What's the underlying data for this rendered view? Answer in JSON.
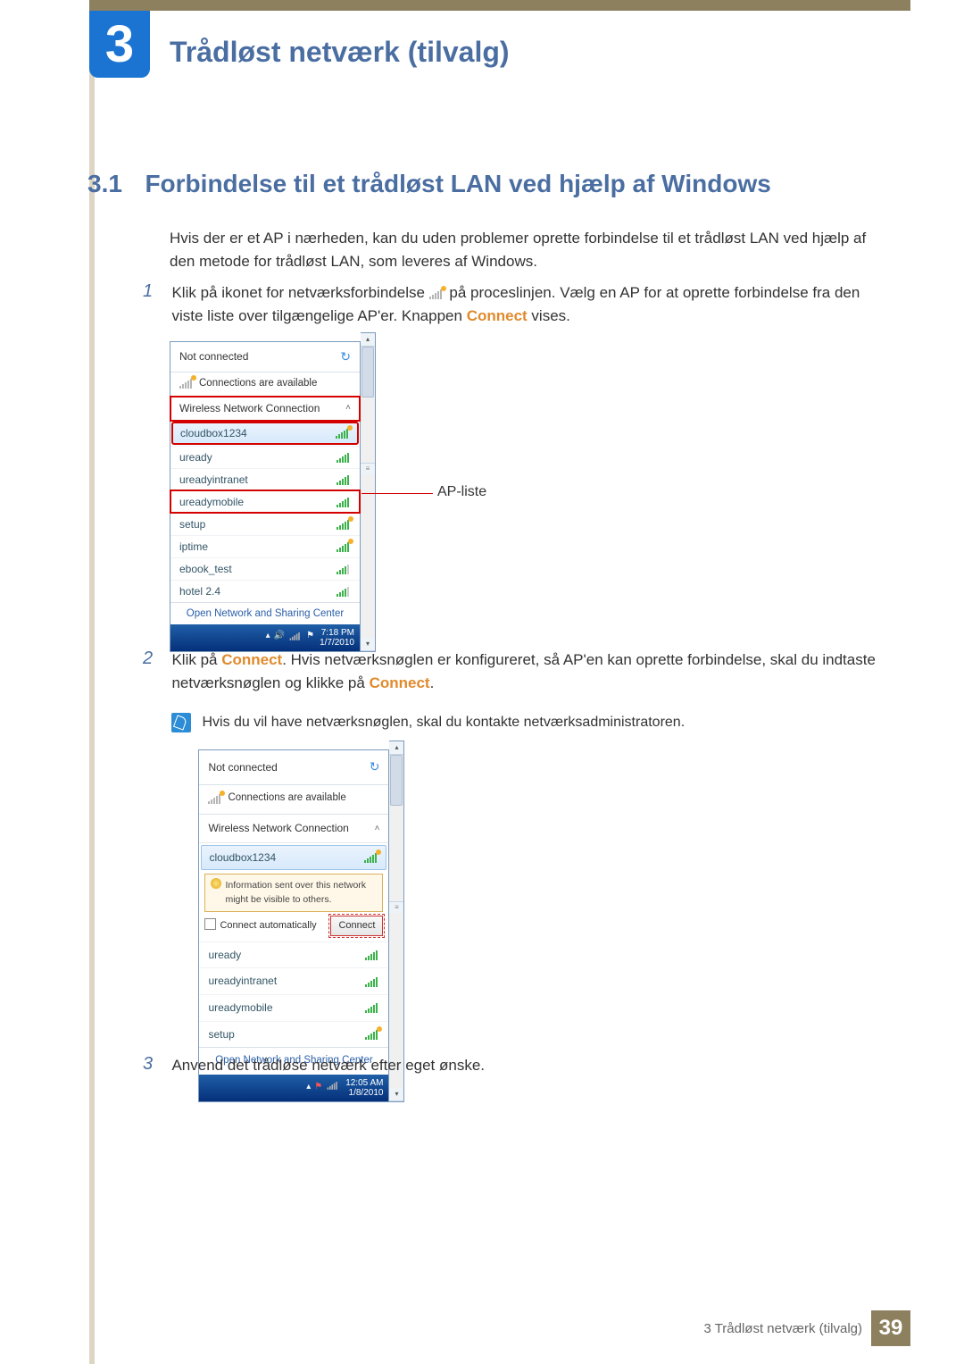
{
  "chapter": {
    "number": "3",
    "title": "Trådløst netværk (tilvalg)"
  },
  "section": {
    "number": "3.1",
    "title": "Forbindelse til et trådløst LAN ved hjælp af Windows"
  },
  "intro": "Hvis der er et AP i nærheden, kan du uden problemer oprette forbindelse til et trådløst LAN ved hjælp af den metode for trådløst LAN, som leveres af Windows.",
  "steps": {
    "s1": {
      "num": "1",
      "pre": "Klik på ikonet for netværksforbindelse ",
      "post1": " på proceslinjen. Vælg en AP for at oprette forbindelse fra den viste liste over tilgængelige AP'er. Knappen ",
      "connect": "Connect",
      "post2": " vises."
    },
    "s2": {
      "num": "2",
      "t1": "Klik på ",
      "connect1": "Connect",
      "t2": ". Hvis netværksnøglen er konfigureret, så AP'en kan oprette forbindelse, skal du indtaste netværksnøglen og klikke på ",
      "connect2": "Connect",
      "t3": "."
    },
    "s3": {
      "num": "3",
      "text": "Anvend det trådløse netværk efter eget ønske."
    }
  },
  "note": "Hvis du vil have netværksnøglen, skal du kontakte netværksadministratoren.",
  "callout": "AP-liste",
  "panel1": {
    "not_connected": "Not connected",
    "available": "Connections are available",
    "section": "Wireless Network Connection",
    "aps": [
      "cloudbox1234",
      "uready",
      "ureadyintranet",
      "ureadymobile",
      "setup",
      "iptime",
      "ebook_test",
      "hotel 2.4"
    ],
    "footer": "Open Network and Sharing Center",
    "time": "7:18 PM",
    "date": "1/7/2010"
  },
  "panel2": {
    "not_connected": "Not connected",
    "available": "Connections are available",
    "section": "Wireless Network Connection",
    "selected": "cloudbox1234",
    "warn": "Information sent over this network might be visible to others.",
    "auto": "Connect automatically",
    "connect_btn": "Connect",
    "aps": [
      "uready",
      "ureadyintranet",
      "ureadymobile",
      "setup"
    ],
    "footer": "Open Network and Sharing Center",
    "time": "12:05 AM",
    "date": "1/8/2010"
  },
  "footer": {
    "text": "3 Trådløst netværk (tilvalg)",
    "page": "39"
  }
}
